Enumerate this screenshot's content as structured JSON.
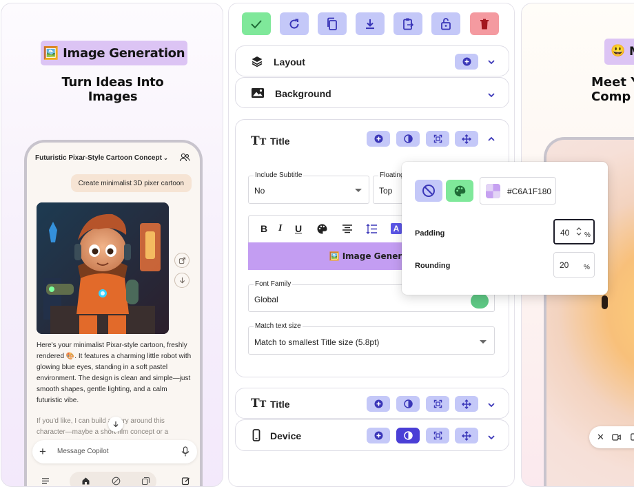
{
  "left_card": {
    "badge_emoji": "🖼️",
    "badge_text": "Image Generation",
    "headline_line1": "Turn Ideas Into",
    "headline_line2": "Images",
    "phone": {
      "conversation_title": "Futuristic Pixar-Style Cartoon Concept",
      "user_prompt": "Create minimalist 3D pixer cartoon",
      "reply_p1": "Here's your minimalist Pixar-style cartoon, freshly rendered 🎨. It features a charming little robot with glowing blue eyes, standing in a soft pastel environment. The design is clean and simple—just smooth shapes, gentle lighting, and a calm futuristic vibe.",
      "reply_p2": "If you'd like, I can build a story around this character—maybe a short film concept or a",
      "input_placeholder": "Message Copilot"
    }
  },
  "toolbar": {
    "buttons": [
      "check-icon",
      "refresh-icon",
      "copy-icon",
      "download-icon",
      "paste-icon",
      "unlock-icon",
      "trash-icon"
    ]
  },
  "sections": {
    "layout": "Layout",
    "background": "Background",
    "title": "Title",
    "title2": "Title",
    "device": "Device"
  },
  "title_panel": {
    "include_subtitle_label": "Include Subtitle",
    "include_subtitle_value": "No",
    "floating_label": "Floating",
    "floating_value": "Top",
    "banner_emoji": "🖼️",
    "banner_text": "Image Generation",
    "font_family_label": "Font Family",
    "font_family_value": "Global",
    "match_size_label": "Match text size",
    "match_size_value": "Match to smallest Title size (5.8pt)"
  },
  "popup": {
    "color_hex": "#C6A1F180",
    "padding_label": "Padding",
    "padding_value": "40",
    "padding_unit": "%",
    "rounding_label": "Rounding",
    "rounding_value": "20",
    "rounding_unit": "%"
  },
  "right_card": {
    "badge_emoji": "😃",
    "badge_text": "M",
    "headline_line1": "Meet Y",
    "headline_line2": "Comp"
  },
  "colors": {
    "accent": "#C4C8F8",
    "accent_active": "#4A3FD6",
    "confirm": "#7FE89A",
    "danger": "#F49AA0",
    "badge": "#DCC4F4",
    "banner": "#C39DF2"
  }
}
